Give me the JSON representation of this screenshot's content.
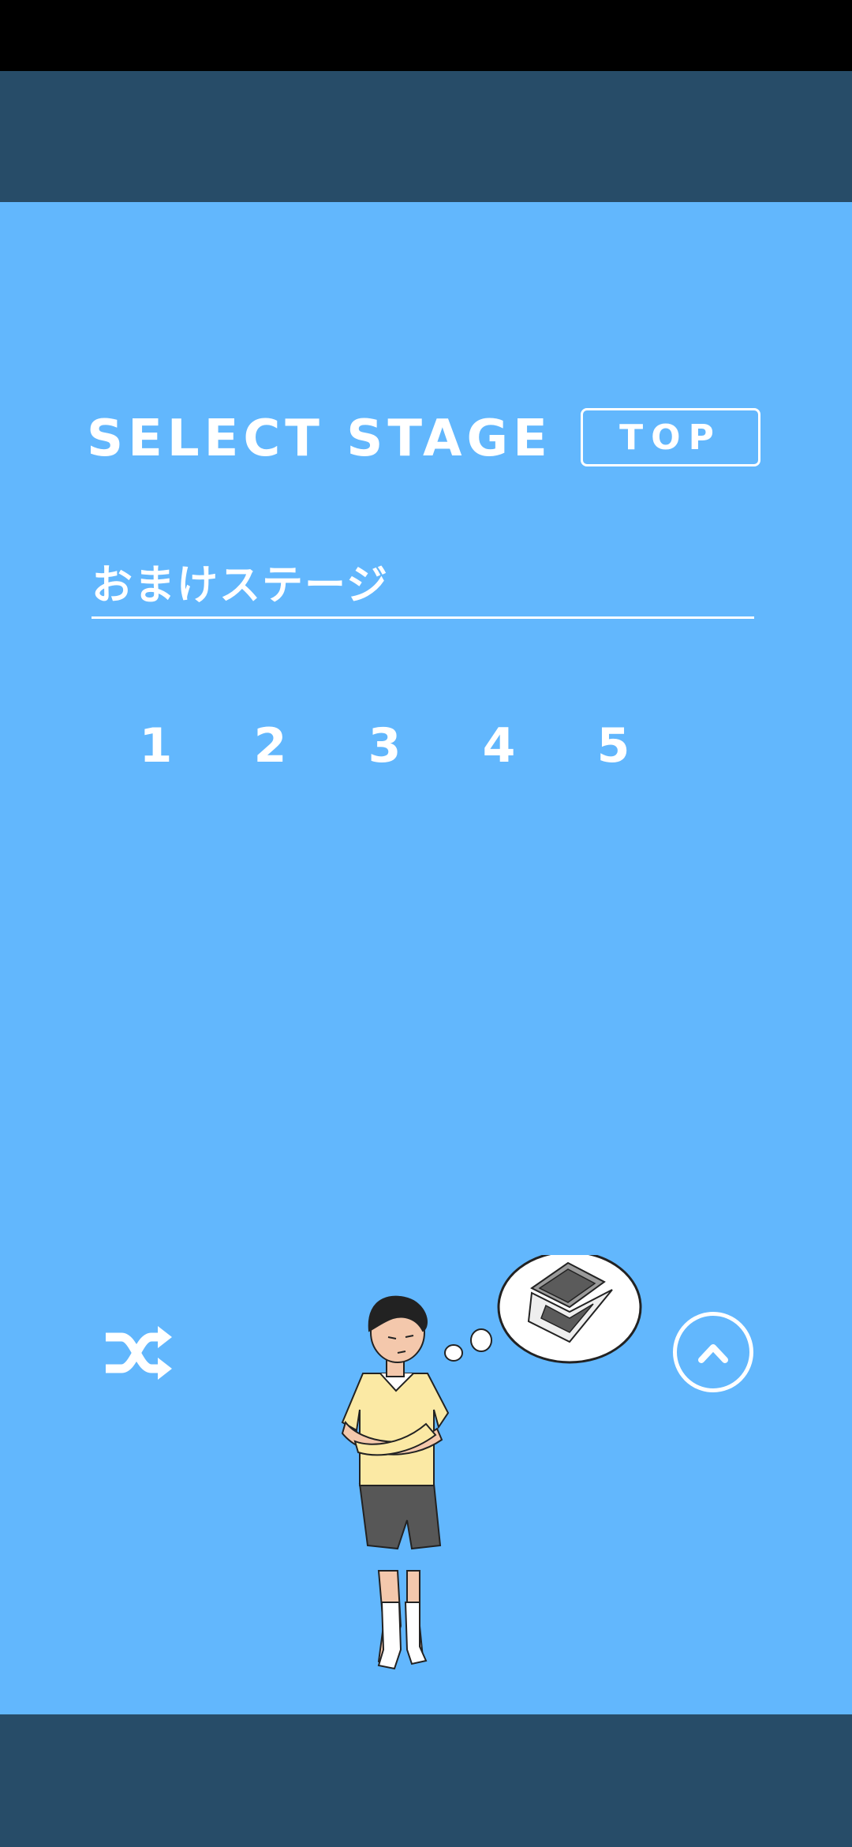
{
  "header": {
    "title": "SELECT STAGE",
    "top_button_label": "TOP"
  },
  "section": {
    "label": "おまけステージ"
  },
  "stages": [
    {
      "label": "1"
    },
    {
      "label": "2"
    },
    {
      "label": "3"
    },
    {
      "label": "4"
    },
    {
      "label": "5"
    }
  ],
  "controls": {
    "shuffle_icon": "shuffle-icon",
    "scroll_up_icon": "chevron-up-icon"
  },
  "colors": {
    "background": "#62b7fd",
    "banner": "#274c68",
    "status_bar": "#000000",
    "text": "#ffffff"
  }
}
